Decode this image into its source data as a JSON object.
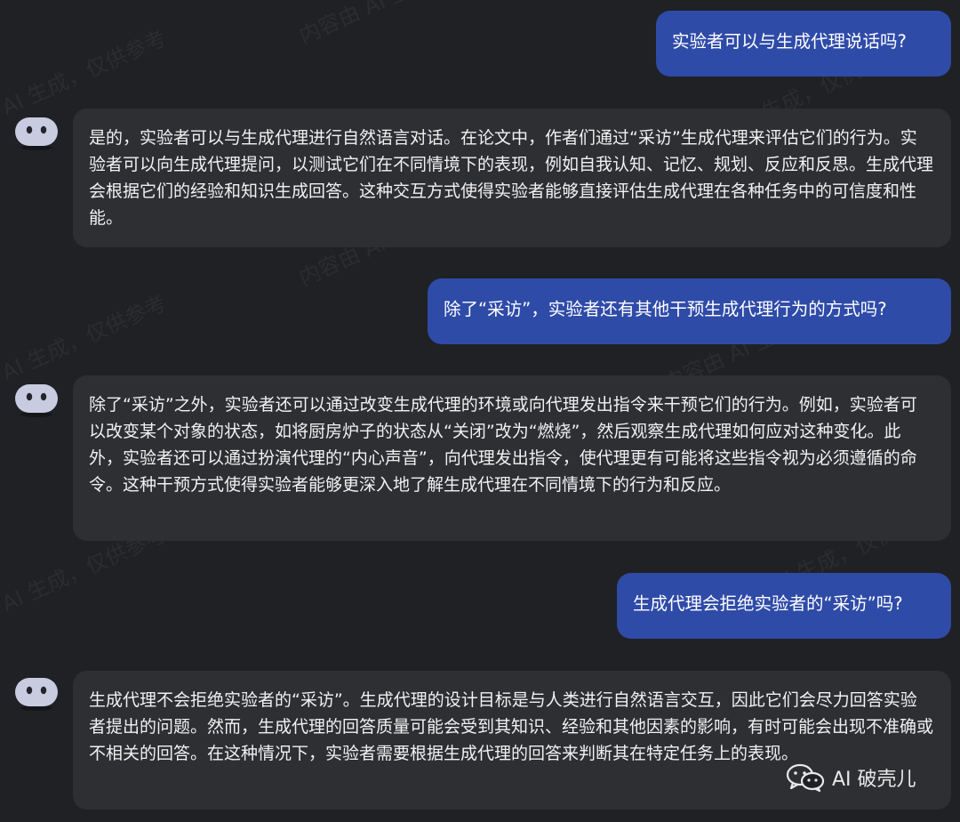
{
  "conversation": {
    "messages": [
      {
        "role": "user",
        "text": "实验者可以与生成代理说话吗?"
      },
      {
        "role": "assistant",
        "text": "是的，实验者可以与生成代理进行自然语言对话。在论文中，作者们通过“采访”生成代理来评估它们的行为。实验者可以向生成代理提问，以测试它们在不同情境下的表现，例如自我认知、记忆、规划、反应和反思。生成代理会根据它们的经验和知识生成回答。这种交互方式使得实验者能够直接评估生成代理在各种任务中的可信度和性能。"
      },
      {
        "role": "user",
        "text": "除了“采访”，实验者还有其他干预生成代理行为的方式吗?"
      },
      {
        "role": "assistant",
        "text": "除了“采访”之外，实验者还可以通过改变生成代理的环境或向代理发出指令来干预它们的行为。例如，实验者可以改变某个对象的状态，如将厨房炉子的状态从“关闭”改为“燃烧”，然后观察生成代理如何应对这种变化。此外，实验者还可以通过扮演代理的“内心声音”，向代理发出指令，使代理更有可能将这些指令视为必须遵循的命令。这种干预方式使得实验者能够更深入地了解生成代理在不同情境下的行为和反应。"
      },
      {
        "role": "user",
        "text": "生成代理会拒绝实验者的“采访”吗?"
      },
      {
        "role": "assistant",
        "text": "生成代理不会拒绝实验者的“采访”。生成代理的设计目标是与人类进行自然语言交互，因此它们会尽力回答实验者提出的问题。然而，生成代理的回答质量可能会受到其知识、经验和其他因素的影响，有时可能会出现不准确或不相关的回答。在这种情况下，实验者需要根据生成代理的回答来判断其在特定任务上的表现。"
      }
    ]
  },
  "watermark": {
    "text": "AI 生成，仅供参考",
    "text2": "内容由 AI 生成"
  },
  "brand": {
    "icon": "wechat-icon",
    "label": "AI 破壳儿"
  },
  "colors": {
    "background": "#202125",
    "user_bubble": "#2f4ba8",
    "assistant_bubble": "#2e2f33",
    "avatar": "#c9cbe0"
  }
}
